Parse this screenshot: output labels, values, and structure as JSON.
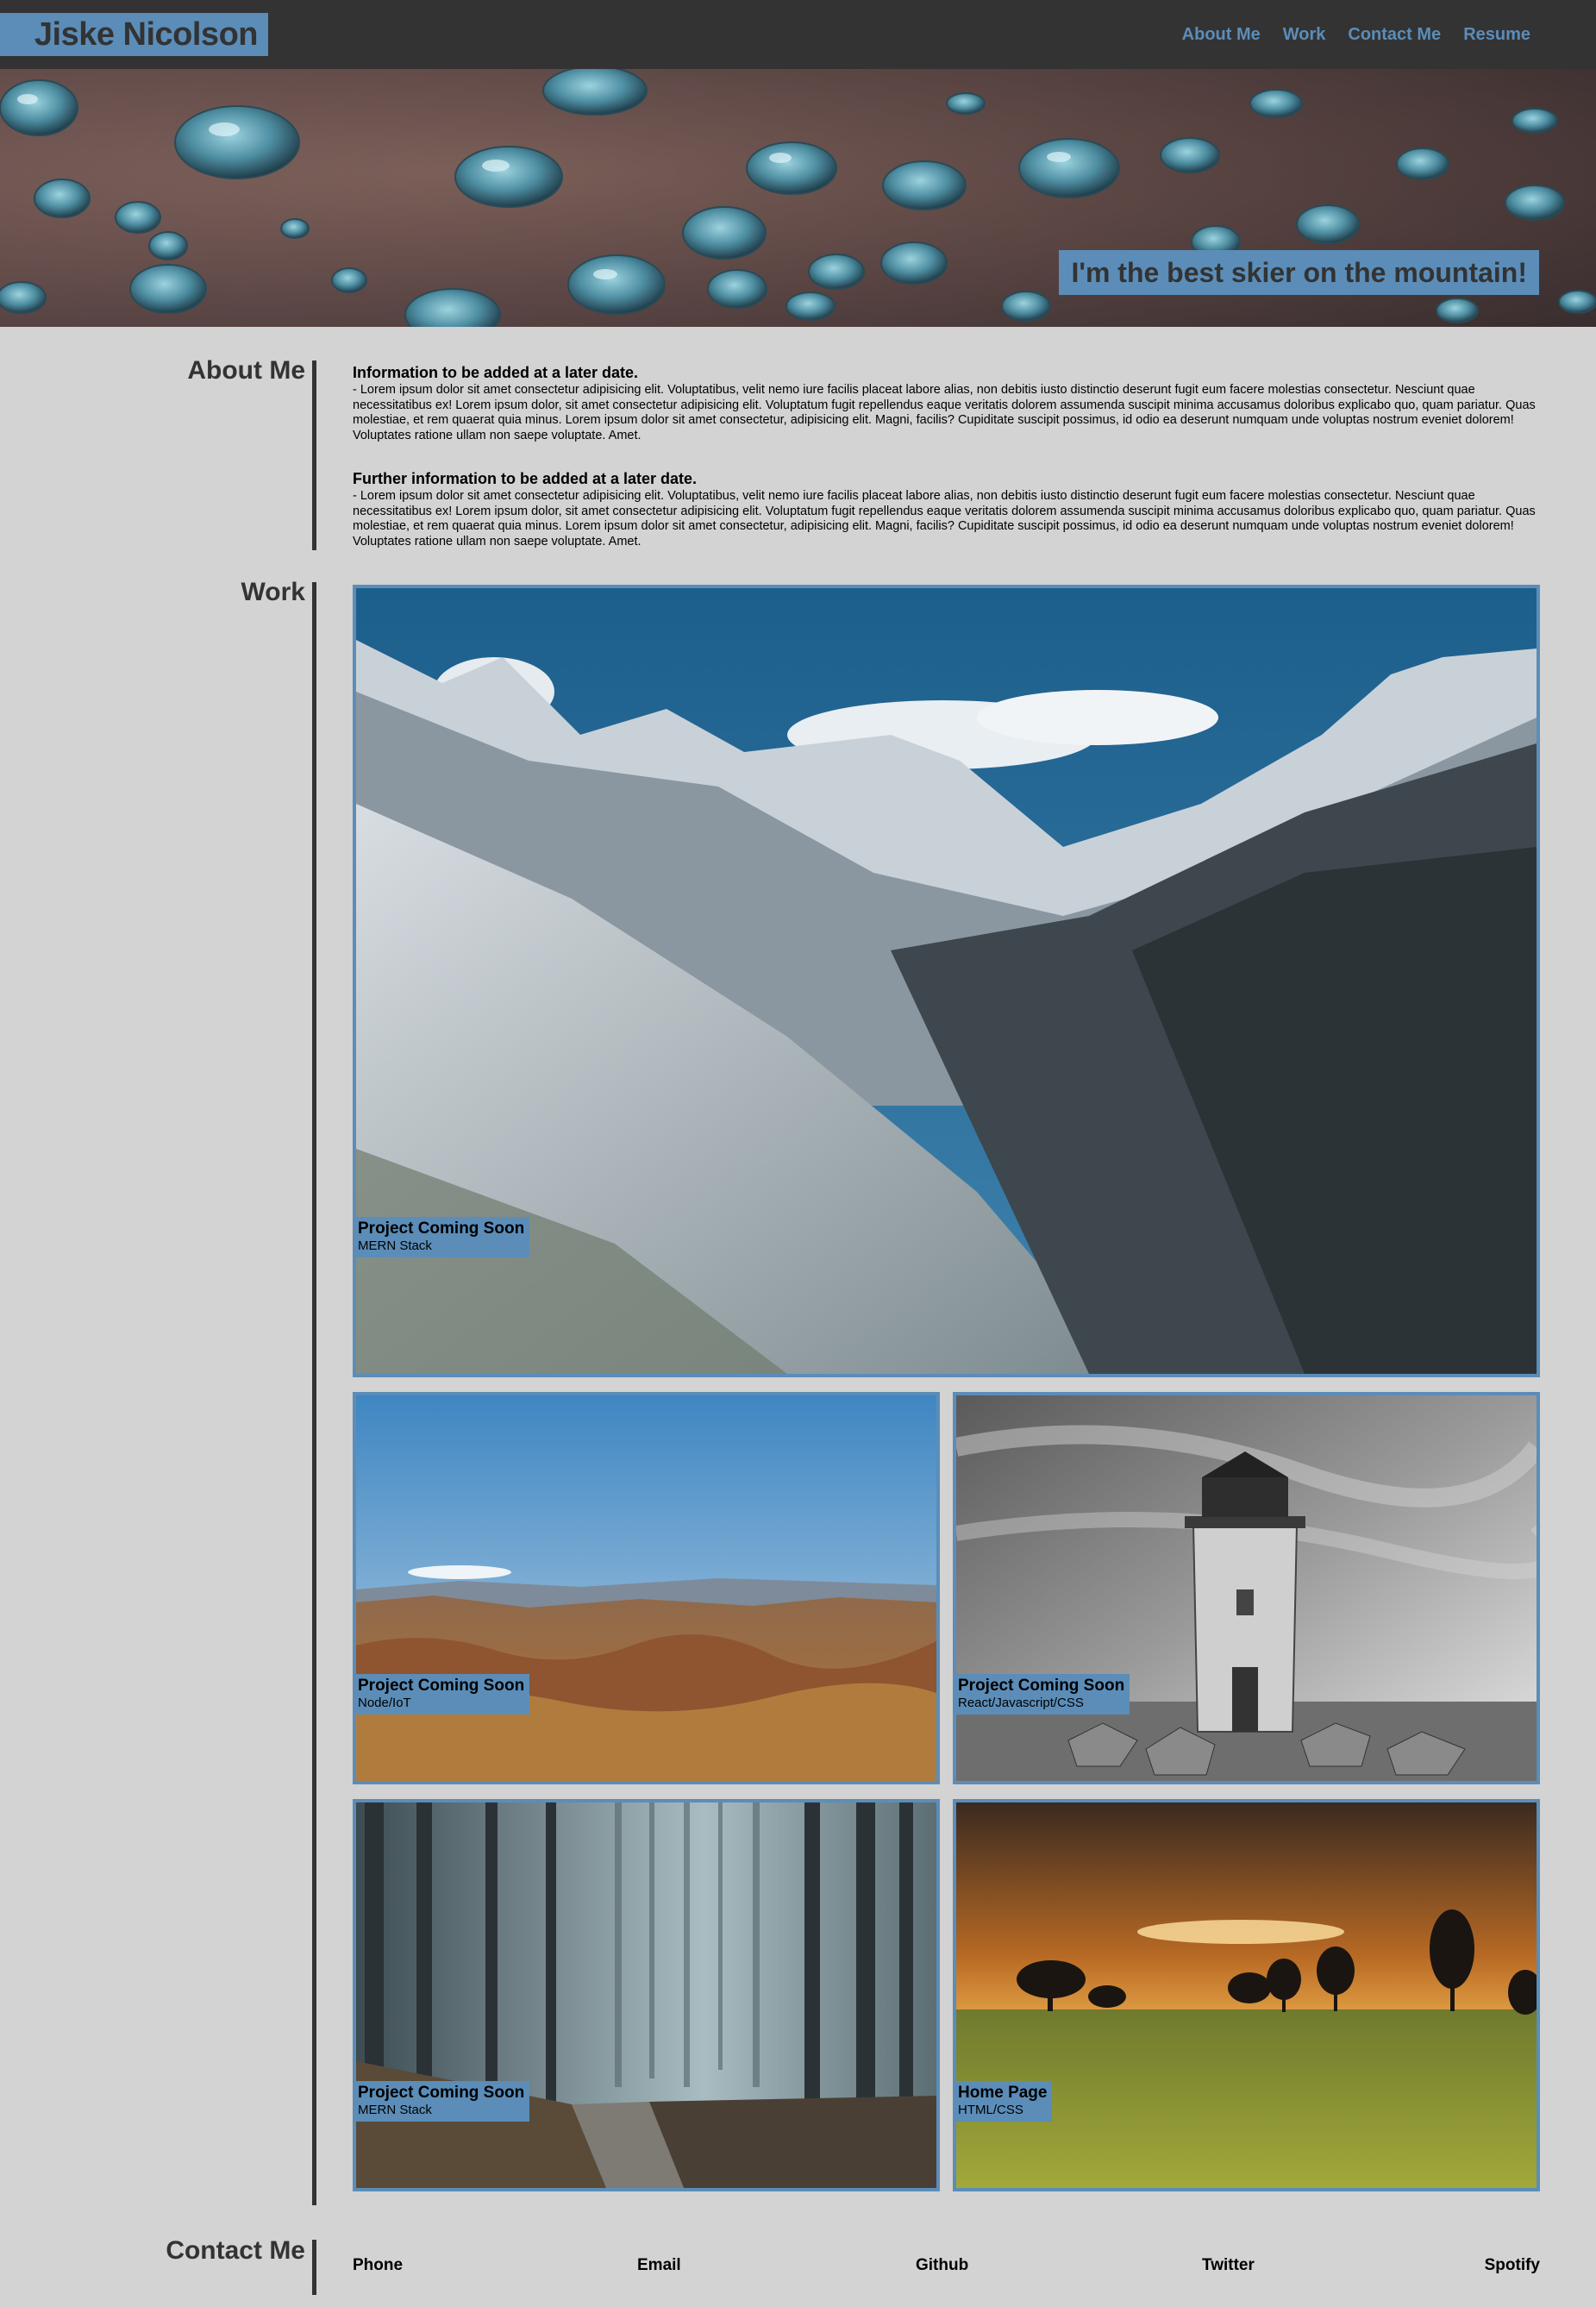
{
  "header": {
    "brand": "Jiske Nicolson",
    "nav": [
      "About Me",
      "Work",
      "Contact Me",
      "Resume"
    ]
  },
  "hero": {
    "tagline": "I'm the best skier on the mountain!"
  },
  "about": {
    "heading": "About Me",
    "blocks": [
      {
        "title": "Information to be added at a later date.",
        "body": "- Lorem ipsum dolor sit amet consectetur adipisicing elit. Voluptatibus, velit nemo iure facilis placeat labore alias, non debitis iusto distinctio deserunt fugit eum facere molestias consectetur. Nesciunt quae necessitatibus ex! Lorem ipsum dolor, sit amet consectetur adipisicing elit. Voluptatum fugit repellendus eaque veritatis dolorem assumenda suscipit minima accusamus doloribus explicabo quo, quam pariatur. Quas molestiae, et rem quaerat quia minus. Lorem ipsum dolor sit amet consectetur, adipisicing elit. Magni, facilis? Cupiditate suscipit possimus, id odio ea deserunt numquam unde voluptas nostrum eveniet dolorem! Voluptates ratione ullam non saepe voluptate. Amet."
      },
      {
        "title": "Further information to be added at a later date.",
        "body": "- Lorem ipsum dolor sit amet consectetur adipisicing elit. Voluptatibus, velit nemo iure facilis placeat labore alias, non debitis iusto distinctio deserunt fugit eum facere molestias consectetur. Nesciunt quae necessitatibus ex! Lorem ipsum dolor, sit amet consectetur adipisicing elit. Voluptatum fugit repellendus eaque veritatis dolorem assumenda suscipit minima accusamus doloribus explicabo quo, quam pariatur. Quas molestiae, et rem quaerat quia minus. Lorem ipsum dolor sit amet consectetur, adipisicing elit. Magni, facilis? Cupiditate suscipit possimus, id odio ea deserunt numquam unde voluptas nostrum eveniet dolorem! Voluptates ratione ullam non saepe voluptate. Amet."
      }
    ]
  },
  "work": {
    "heading": "Work",
    "projects": [
      {
        "title": "Project Coming Soon",
        "stack": "MERN Stack",
        "image": "snowy-mountains-photo"
      },
      {
        "title": "Project Coming Soon",
        "stack": "Node/IoT",
        "image": "desert-hills-photo"
      },
      {
        "title": "Project Coming Soon",
        "stack": "React/Javascript/CSS",
        "image": "lighthouse-photo"
      },
      {
        "title": "Project Coming Soon",
        "stack": "MERN Stack",
        "image": "misty-forest-photo"
      },
      {
        "title": "Home Page",
        "stack": "HTML/CSS",
        "image": "sunset-field-photo"
      }
    ]
  },
  "contact": {
    "heading": "Contact Me",
    "links": [
      "Phone",
      "Email",
      "Github",
      "Twitter",
      "Spotify"
    ]
  },
  "colors": {
    "accent": "#5b8db8",
    "dark": "#333333",
    "background": "#d3d3d3"
  }
}
